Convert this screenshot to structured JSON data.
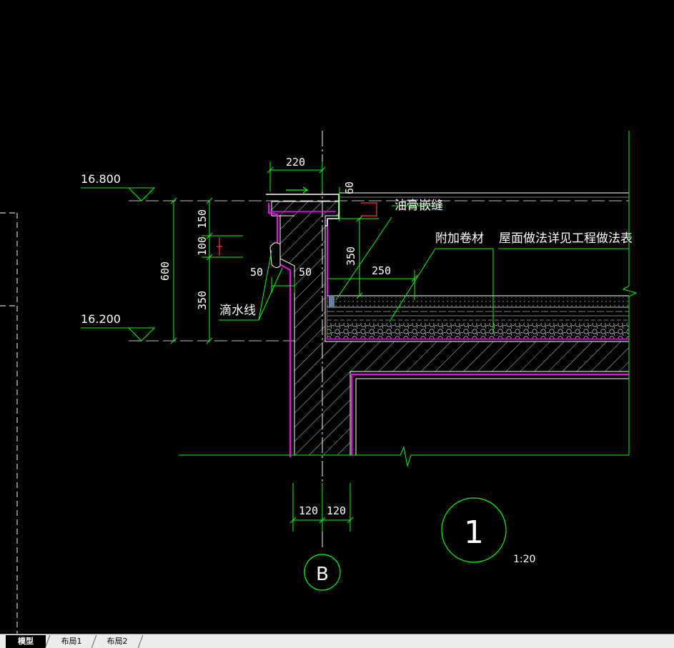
{
  "drawing": {
    "elevations": {
      "top": "16.800",
      "bottom": "16.200"
    },
    "dimensions": {
      "parapet_width": "220",
      "coping_height": "60",
      "seg_150": "150",
      "seg_100": "100",
      "seg_350_left": "350",
      "total_600": "600",
      "drip_50_left": "50",
      "drip_50_right": "50",
      "upturn_350": "350",
      "flash_250": "250",
      "wall_120_left": "120",
      "wall_120_right": "120"
    },
    "annotations": {
      "sealant": "油膏嵌缝",
      "extra_membrane": "附加卷材",
      "roof_note": "屋面做法详见工程做法表",
      "drip_line": "滴水线"
    },
    "detail_number": "1",
    "scale": "1:20",
    "axis_label": "B"
  },
  "tabs": {
    "model": "模型",
    "layout1": "布局1",
    "layout2": "布局2"
  },
  "colors": {
    "background": "#000000",
    "line_green": "#00ff00",
    "magenta": "#ff00ff",
    "white": "#ffffff",
    "red": "#ff3333"
  }
}
